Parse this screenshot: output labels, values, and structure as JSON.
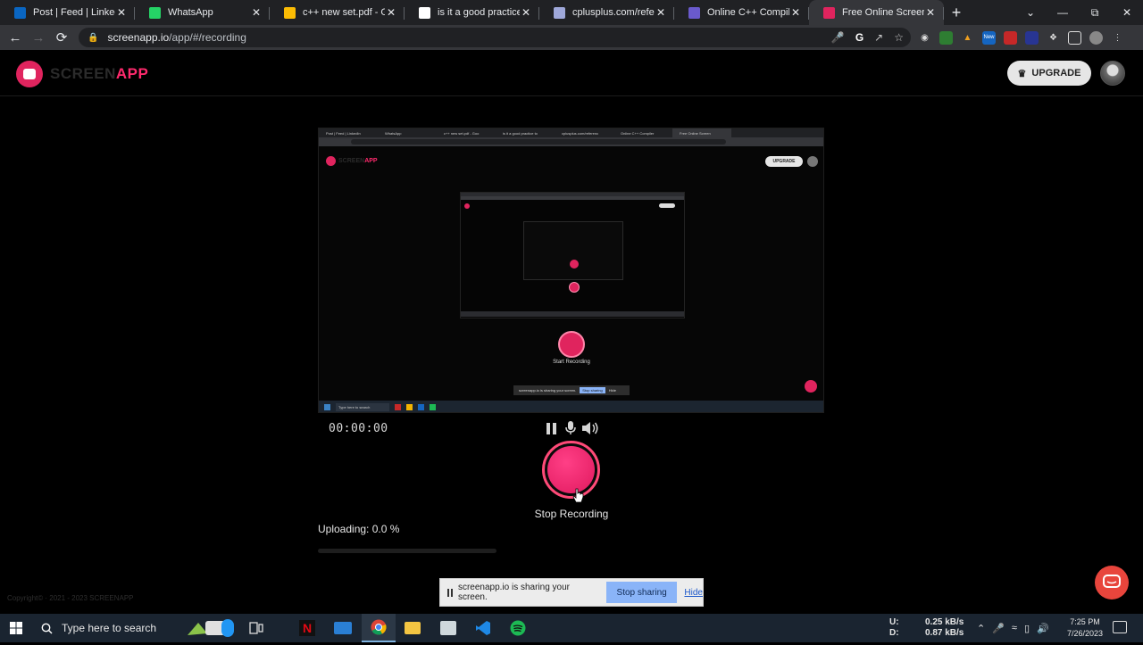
{
  "browser": {
    "tabs": [
      {
        "title": "Post | Feed | LinkedIn",
        "icon": "linkedin-icon",
        "color": "#0a66c2"
      },
      {
        "title": "WhatsApp",
        "icon": "whatsapp-icon",
        "color": "#25d366"
      },
      {
        "title": "c++ new set.pdf - Goo",
        "icon": "google-drive-icon",
        "color": "#fbbc04"
      },
      {
        "title": "is it a good practice to",
        "icon": "google-icon",
        "color": "#ffffff"
      },
      {
        "title": "cplusplus.com/referenc",
        "icon": "cplusplus-icon",
        "color": "#9fa8da"
      },
      {
        "title": "Online C++ Compiler -",
        "icon": "compiler-icon",
        "color": "#6a5acd"
      },
      {
        "title": "Free Online Screen",
        "icon": "screenapp-icon",
        "color": "#e0245e"
      }
    ],
    "new_tab_symbol": "+",
    "url_host": "screenapp.io",
    "url_path": "/app/#/recording"
  },
  "app": {
    "logo_dark": "SCREEN",
    "logo_pink": "APP",
    "upgrade_label": "UPGRADE",
    "brand_color": "#ff2a6d"
  },
  "preview": {
    "tabs": [
      "Post | Feed | LinkedIn",
      "WhatsApp",
      "c++ new set.pdf - Goo",
      "is it a good practice to",
      "cplusplus.com/referenc",
      "Online C++ Compiler",
      "Free Online Screen"
    ],
    "logo": "SCREENAPP",
    "upgrade": "UPGRADE",
    "start_label": "Start Recording",
    "share_text": "screenapp.io is sharing your screen.",
    "share_stop": "Stop sharing",
    "share_hide": "Hide",
    "search_text": "Type here to search"
  },
  "recorder": {
    "timer": "00:00:00",
    "stop_label": "Stop Recording",
    "upload_label": "Uploading: 0.0 %",
    "upload_fraction": 0.0
  },
  "footer": {
    "copyright": "Copyright© · 2021 - 2023 SCREENAPP"
  },
  "sharing_banner": {
    "text": "screenapp.io is sharing your screen.",
    "stop_label": "Stop sharing",
    "hide_label": "Hide"
  },
  "taskbar": {
    "search_placeholder": "Type here to search",
    "net_up_label": "U:",
    "net_up": "0.25 kB/s",
    "net_down_label": "D:",
    "net_down": "0.87 kB/s",
    "time": "7:25 PM",
    "date": "7/26/2023"
  }
}
